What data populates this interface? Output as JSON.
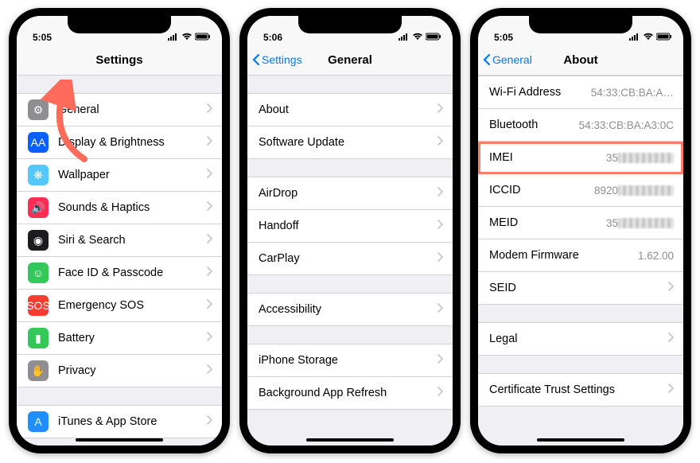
{
  "phones": [
    {
      "time": "5:05",
      "title": "Settings",
      "back": null,
      "groups": [
        {
          "rows": [
            {
              "icon": "gear",
              "color": "#8e8e93",
              "label": "General",
              "chev": true
            },
            {
              "icon": "AA",
              "color": "#0a60ff",
              "label": "Display & Brightness",
              "chev": true
            },
            {
              "icon": "flower",
              "color": "#54c7fc",
              "label": "Wallpaper",
              "chev": true
            },
            {
              "icon": "speaker",
              "color": "#ff2d55",
              "label": "Sounds & Haptics",
              "chev": true
            },
            {
              "icon": "siri",
              "color": "#1c1c1e",
              "label": "Siri & Search",
              "chev": true
            },
            {
              "icon": "faceid",
              "color": "#34c759",
              "label": "Face ID & Passcode",
              "chev": true
            },
            {
              "icon": "SOS",
              "color": "#ff3b30",
              "label": "Emergency SOS",
              "chev": true
            },
            {
              "icon": "battery",
              "color": "#34c759",
              "label": "Battery",
              "chev": true
            },
            {
              "icon": "hand",
              "color": "#8e8e93",
              "label": "Privacy",
              "chev": true
            }
          ]
        },
        {
          "rows": [
            {
              "icon": "A",
              "color": "#1f8fff",
              "label": "iTunes & App Store",
              "chev": true
            }
          ]
        }
      ]
    },
    {
      "time": "5:06",
      "title": "General",
      "back": "Settings",
      "groups": [
        {
          "rows": [
            {
              "label": "About",
              "chev": true
            },
            {
              "label": "Software Update",
              "chev": true
            }
          ]
        },
        {
          "rows": [
            {
              "label": "AirDrop",
              "chev": true
            },
            {
              "label": "Handoff",
              "chev": true
            },
            {
              "label": "CarPlay",
              "chev": true
            }
          ]
        },
        {
          "rows": [
            {
              "label": "Accessibility",
              "chev": true
            }
          ]
        },
        {
          "rows": [
            {
              "label": "iPhone Storage",
              "chev": true
            },
            {
              "label": "Background App Refresh",
              "chev": true
            }
          ]
        }
      ]
    },
    {
      "time": "5:05",
      "title": "About",
      "back": "General",
      "groups": [
        {
          "tight": true,
          "rows": [
            {
              "label": "Wi-Fi Address",
              "value": "54:33:CB:BA:A…"
            },
            {
              "label": "Bluetooth",
              "value": "54:33:CB:BA:A3:0C"
            },
            {
              "label": "IMEI",
              "value": "35",
              "blur": true,
              "highlight": true
            },
            {
              "label": "ICCID",
              "value": "8920",
              "blur": true
            },
            {
              "label": "MEID",
              "value": "35",
              "blur": true
            },
            {
              "label": "Modem Firmware",
              "value": "1.62.00"
            },
            {
              "label": "SEID",
              "chev": true
            }
          ]
        },
        {
          "rows": [
            {
              "label": "Legal",
              "chev": true
            }
          ]
        },
        {
          "rows": [
            {
              "label": "Certificate Trust Settings",
              "chev": true
            }
          ]
        }
      ]
    }
  ],
  "icons_svg": {
    "signal": "",
    "wifi": "",
    "battery": ""
  }
}
